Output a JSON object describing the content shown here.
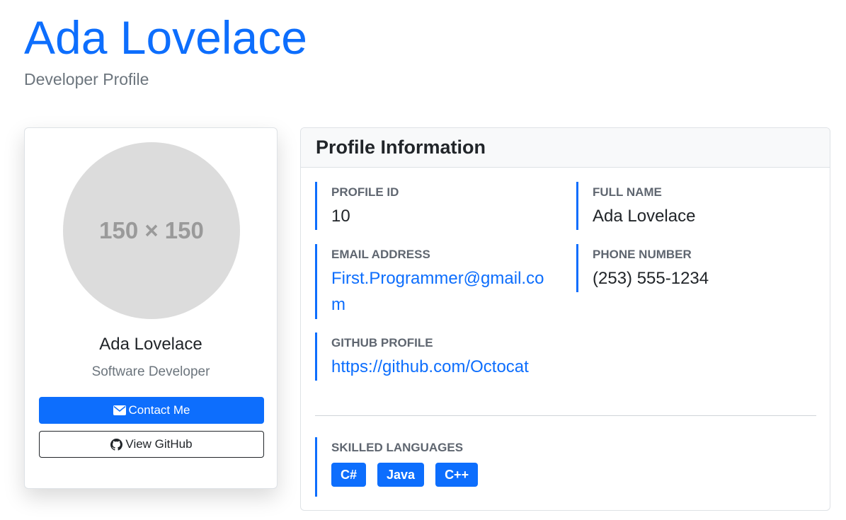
{
  "header": {
    "title": "Ada Lovelace",
    "subtitle": "Developer Profile"
  },
  "card": {
    "avatar_text": "150 × 150",
    "name": "Ada Lovelace",
    "role": "Software Developer",
    "contact_label": "Contact Me",
    "github_label": "View GitHub",
    "contact_icon": "envelope-icon",
    "github_icon": "github-icon"
  },
  "info": {
    "title": "Profile Information",
    "profile_id": {
      "label": "PROFILE ID",
      "value": "10"
    },
    "full_name": {
      "label": "FULL NAME",
      "value": "Ada Lovelace"
    },
    "email": {
      "label": "EMAIL ADDRESS",
      "value": "First.Programmer@gmail.com"
    },
    "phone": {
      "label": "PHONE NUMBER",
      "value": "(253) 555-1234"
    },
    "github": {
      "label": "GITHUB PROFILE",
      "value": "https://github.com/Octocat"
    },
    "skills": {
      "label": "SKILLED LANGUAGES",
      "items": [
        "C#",
        "Java",
        "C++"
      ]
    }
  },
  "colors": {
    "accent": "#0d6efd",
    "muted": "#6c757d"
  }
}
